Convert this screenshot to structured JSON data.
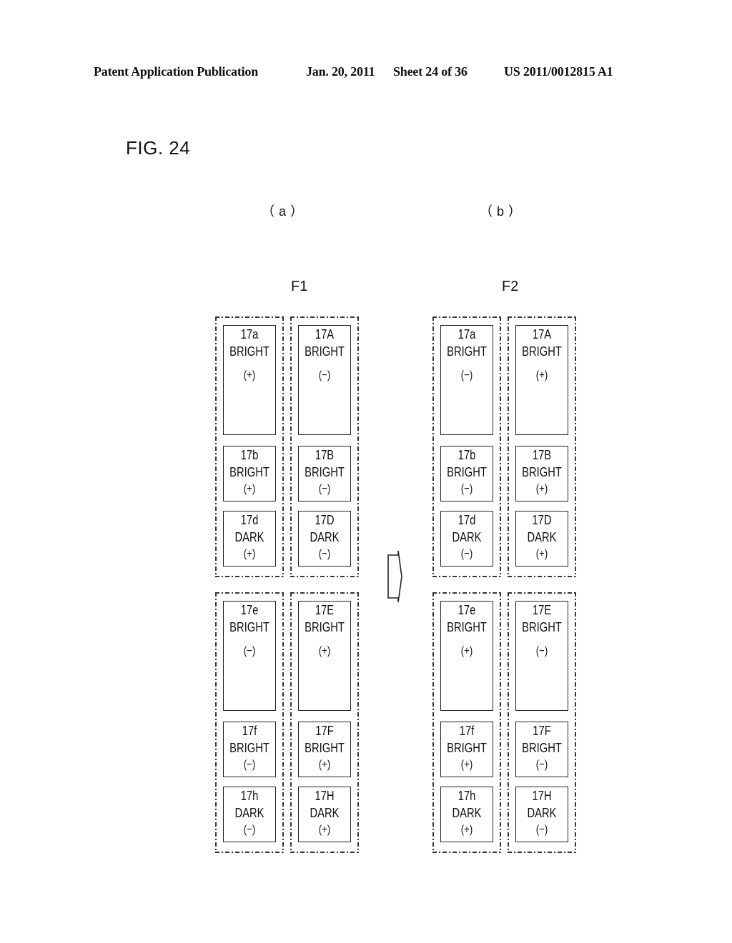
{
  "header": {
    "publication": "Patent Application Publication",
    "date": "Jan. 20, 2011",
    "sheet": "Sheet 24 of 36",
    "number": "US 2011/0012815 A1"
  },
  "figure": {
    "title": "FIG. 24",
    "panels": [
      {
        "label": "（a）",
        "frame": "F1",
        "groups": [
          {
            "cells": [
              {
                "id": "17a",
                "state": "BRIGHT",
                "polarity": "(+)"
              },
              {
                "id": "17b",
                "state": "BRIGHT",
                "polarity": "(+)"
              },
              {
                "id": "17d",
                "state": "DARK",
                "polarity": "(+)"
              }
            ]
          },
          {
            "cells": [
              {
                "id": "17A",
                "state": "BRIGHT",
                "polarity": "(−)"
              },
              {
                "id": "17B",
                "state": "BRIGHT",
                "polarity": "(−)"
              },
              {
                "id": "17D",
                "state": "DARK",
                "polarity": "(−)"
              }
            ]
          },
          {
            "cells": [
              {
                "id": "17e",
                "state": "BRIGHT",
                "polarity": "(−)"
              },
              {
                "id": "17f",
                "state": "BRIGHT",
                "polarity": "(−)"
              },
              {
                "id": "17h",
                "state": "DARK",
                "polarity": "(−)"
              }
            ]
          },
          {
            "cells": [
              {
                "id": "17E",
                "state": "BRIGHT",
                "polarity": "(+)"
              },
              {
                "id": "17F",
                "state": "BRIGHT",
                "polarity": "(+)"
              },
              {
                "id": "17H",
                "state": "DARK",
                "polarity": "(+)"
              }
            ]
          }
        ]
      },
      {
        "label": "（b）",
        "frame": "F2",
        "groups": [
          {
            "cells": [
              {
                "id": "17a",
                "state": "BRIGHT",
                "polarity": "(−)"
              },
              {
                "id": "17b",
                "state": "BRIGHT",
                "polarity": "(−)"
              },
              {
                "id": "17d",
                "state": "DARK",
                "polarity": "(−)"
              }
            ]
          },
          {
            "cells": [
              {
                "id": "17A",
                "state": "BRIGHT",
                "polarity": "(+)"
              },
              {
                "id": "17B",
                "state": "BRIGHT",
                "polarity": "(+)"
              },
              {
                "id": "17D",
                "state": "DARK",
                "polarity": "(+)"
              }
            ]
          },
          {
            "cells": [
              {
                "id": "17e",
                "state": "BRIGHT",
                "polarity": "(+)"
              },
              {
                "id": "17f",
                "state": "BRIGHT",
                "polarity": "(+)"
              },
              {
                "id": "17h",
                "state": "DARK",
                "polarity": "(+)"
              }
            ]
          },
          {
            "cells": [
              {
                "id": "17E",
                "state": "BRIGHT",
                "polarity": "(−)"
              },
              {
                "id": "17F",
                "state": "BRIGHT",
                "polarity": "(−)"
              },
              {
                "id": "17H",
                "state": "DARK",
                "polarity": "(−)"
              }
            ]
          }
        ]
      }
    ],
    "transition_icon": "right-arrow-icon"
  }
}
